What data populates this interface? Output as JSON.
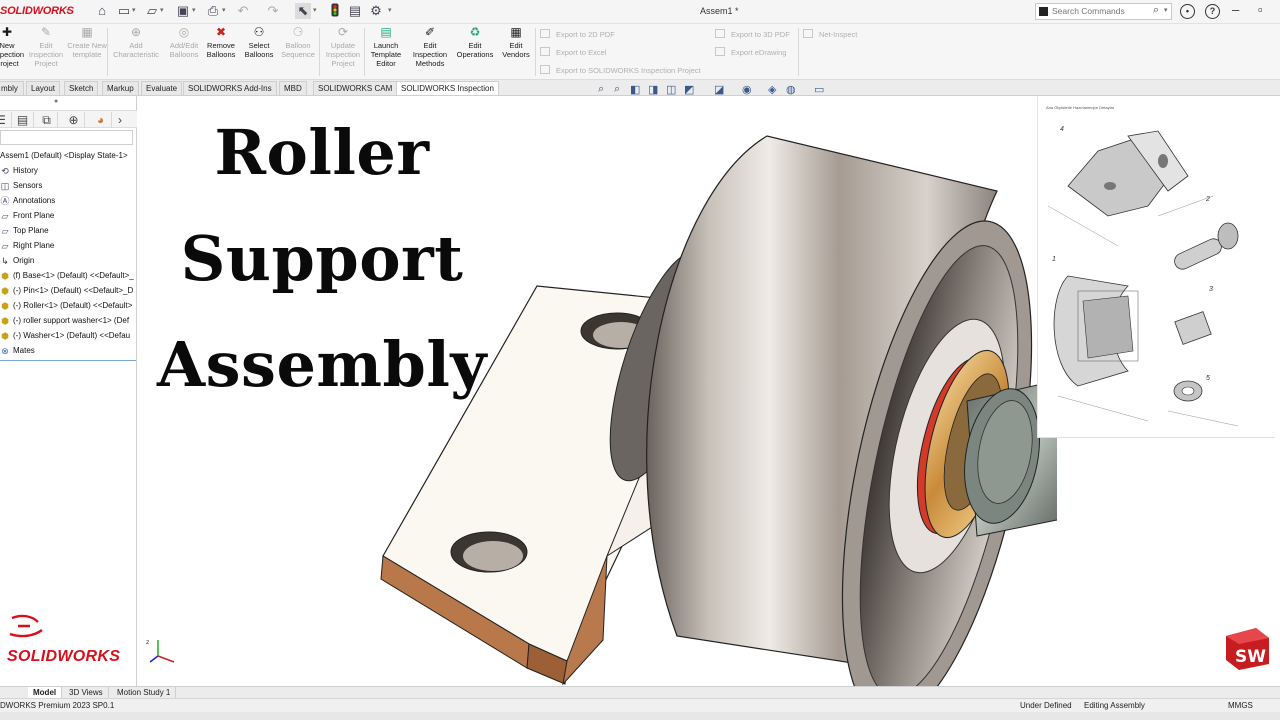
{
  "window": {
    "app_logo": "SOLIDWORKS",
    "document_title": "Assem1 *"
  },
  "search": {
    "placeholder": "Search Commands"
  },
  "quick_access_icons": [
    "home-icon",
    "new-document-icon",
    "open-icon",
    "save-icon",
    "print-icon",
    "undo-icon",
    "redo-icon",
    "select-icon",
    "traffic-light-icon",
    "file-properties-icon",
    "gear-icon"
  ],
  "ribbon": {
    "buttons": [
      {
        "label": "New Inspection Project",
        "enabled": true
      },
      {
        "label": "Edit Inspection Project",
        "enabled": false
      },
      {
        "label": "Create New template",
        "enabled": false
      },
      {
        "label": "Add Characteristic",
        "enabled": false
      },
      {
        "label": "Add/Edit Balloons",
        "enabled": false
      },
      {
        "label": "Remove Balloons",
        "enabled": true
      },
      {
        "label": "Select Balloons",
        "enabled": true
      },
      {
        "label": "Balloon Sequence",
        "enabled": false
      },
      {
        "label": "Update Inspection Project",
        "enabled": false
      },
      {
        "label": "Launch Template Editor",
        "enabled": true
      },
      {
        "label": "Edit Inspection Methods",
        "enabled": true
      },
      {
        "label": "Edit Operations",
        "enabled": true
      },
      {
        "label": "Edit Vendors",
        "enabled": true
      }
    ],
    "export_items": [
      "Export to 2D PDF",
      "Export to Excel",
      "Export to SOLIDWORKS Inspection Project",
      "Export to 3D PDF",
      "Export eDrawing",
      "Net-Inspect"
    ]
  },
  "tabs": [
    "mbly",
    "Layout",
    "Sketch",
    "Markup",
    "Evaluate",
    "SOLIDWORKS Add-Ins",
    "MBD",
    "SOLIDWORKS CAM",
    "SOLIDWORKS Inspection"
  ],
  "active_tab": "SOLIDWORKS Inspection",
  "feature_tree": [
    {
      "label": "Assem1 (Default) <Display State-1>",
      "icon": "assembly-icon"
    },
    {
      "label": "History",
      "icon": "history-icon"
    },
    {
      "label": "Sensors",
      "icon": "sensor-icon"
    },
    {
      "label": "Annotations",
      "icon": "annotations-icon"
    },
    {
      "label": "Front Plane",
      "icon": "plane-icon"
    },
    {
      "label": "Top Plane",
      "icon": "plane-icon"
    },
    {
      "label": "Right Plane",
      "icon": "plane-icon"
    },
    {
      "label": "Origin",
      "icon": "origin-icon"
    },
    {
      "label": "(f) Base<1> (Default) <<Default>_",
      "icon": "part-icon"
    },
    {
      "label": "(-) Pin<1> (Default) <<Default>_D",
      "icon": "part-icon"
    },
    {
      "label": "(-) Roller<1> (Default) <<Default>",
      "icon": "part-icon"
    },
    {
      "label": "(-) roller support  washer<1> (Def",
      "icon": "part-icon"
    },
    {
      "label": "(-) Washer<1> (Default) <<Defau",
      "icon": "part-icon"
    },
    {
      "label": "Mates",
      "icon": "mates-icon"
    }
  ],
  "overlay_title": {
    "line1": "Roller",
    "line2": "Support",
    "line3": "Assembly"
  },
  "drawing_sheet": {
    "title": "Ana Ölçeklerle Hazırlanmıştır Detaylar",
    "callouts": [
      "4",
      "2",
      "1",
      "3",
      "5"
    ]
  },
  "brand_watermark": "SOLIDWORKS",
  "bottom_tabs": [
    "Model",
    "3D Views",
    "Motion Study 1"
  ],
  "active_bottom_tab": "Model",
  "status": {
    "version": "DWORKS Premium 2023 SP0.1",
    "definition": "Under Defined",
    "mode": "Editing Assembly",
    "units": "MMGS"
  },
  "colors": {
    "brand_red": "#d6101c",
    "accent_blue": "#7aa7d8"
  }
}
